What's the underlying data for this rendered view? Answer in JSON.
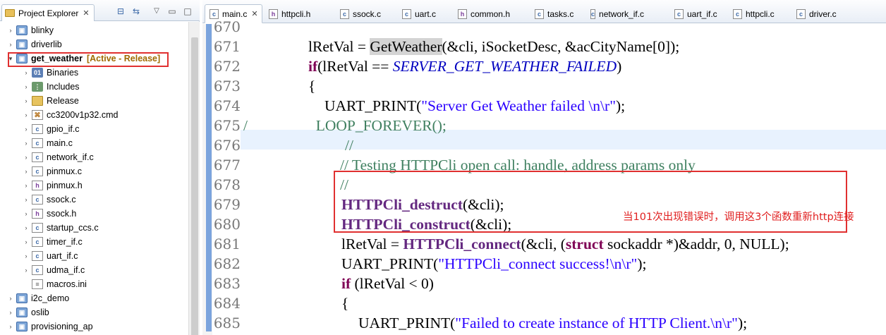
{
  "explorer": {
    "title": "Project Explorer",
    "tree": [
      {
        "label": "blinky",
        "twisty": "›",
        "icon": "project-icon"
      },
      {
        "label": "driverlib",
        "twisty": "›",
        "icon": "project-icon"
      },
      {
        "label": "get_weather",
        "twisty": "▾",
        "icon": "project-icon",
        "status": "[Active - Release]"
      },
      {
        "label": "Binaries",
        "twisty": "›",
        "icon": "binaries-icon"
      },
      {
        "label": "Includes",
        "twisty": "›",
        "icon": "includes-icon"
      },
      {
        "label": "Release",
        "twisty": "›",
        "icon": "folder-icon"
      },
      {
        "label": "cc3200v1p32.cmd",
        "twisty": "›",
        "icon": "cmd-file-icon"
      },
      {
        "label": "gpio_if.c",
        "twisty": "›",
        "icon": "c-file-icon"
      },
      {
        "label": "main.c",
        "twisty": "›",
        "icon": "c-file-icon"
      },
      {
        "label": "network_if.c",
        "twisty": "›",
        "icon": "c-file-icon"
      },
      {
        "label": "pinmux.c",
        "twisty": "›",
        "icon": "c-file-icon"
      },
      {
        "label": "pinmux.h",
        "twisty": "›",
        "icon": "h-file-icon"
      },
      {
        "label": "ssock.c",
        "twisty": "›",
        "icon": "c-file-icon"
      },
      {
        "label": "ssock.h",
        "twisty": "›",
        "icon": "h-file-icon"
      },
      {
        "label": "startup_ccs.c",
        "twisty": "›",
        "icon": "c-file-icon"
      },
      {
        "label": "timer_if.c",
        "twisty": "›",
        "icon": "c-file-icon"
      },
      {
        "label": "uart_if.c",
        "twisty": "›",
        "icon": "c-file-icon"
      },
      {
        "label": "udma_if.c",
        "twisty": "›",
        "icon": "c-file-icon"
      },
      {
        "label": "macros.ini",
        "twisty": "",
        "icon": "ini-file-icon"
      },
      {
        "label": "i2c_demo",
        "twisty": "›",
        "icon": "project-icon"
      },
      {
        "label": "oslib",
        "twisty": "›",
        "icon": "project-icon"
      },
      {
        "label": "provisioning_ap",
        "twisty": "›",
        "icon": "project-icon"
      }
    ]
  },
  "editor": {
    "tabs": [
      {
        "label": "main.c",
        "type": "c",
        "active": true
      },
      {
        "label": "httpcli.h",
        "type": "h"
      },
      {
        "label": "ssock.c",
        "type": "c"
      },
      {
        "label": "uart.c",
        "type": "c"
      },
      {
        "label": "common.h",
        "type": "h"
      },
      {
        "label": "tasks.c",
        "type": "c"
      },
      {
        "label": "network_if.c",
        "type": "c"
      },
      {
        "label": "uart_if.c",
        "type": "c"
      },
      {
        "label": "httpcli.c",
        "type": "c"
      },
      {
        "label": "driver.c",
        "type": "c"
      }
    ],
    "lines": [
      {
        "num": "670",
        "indent": 186,
        "segs": [
          [
            "",
            ""
          ]
        ]
      },
      {
        "num": "671",
        "indent": 92,
        "segs": [
          [
            "",
            "lRetVal = "
          ],
          [
            "hl",
            "GetWeather"
          ],
          [
            "",
            "(&cli, iSocketDesc, &acCityName[0]);"
          ]
        ]
      },
      {
        "num": "672",
        "indent": 92,
        "segs": [
          [
            "kw",
            "if"
          ],
          [
            "",
            "(lRetVal == "
          ],
          [
            "mac",
            "SERVER_GET_WEATHER_FAILED"
          ],
          [
            "",
            ")"
          ]
        ]
      },
      {
        "num": "673",
        "indent": 92,
        "segs": [
          [
            "",
            "{"
          ]
        ]
      },
      {
        "num": "674",
        "indent": 115,
        "segs": [
          [
            "",
            "UART_PRINT("
          ],
          [
            "str",
            "\"Server Get Weather failed \\n\\r\""
          ],
          [
            "",
            ");"
          ]
        ]
      },
      {
        "num": "675",
        "indent": -6,
        "segs": [
          [
            "cm",
            "//                  LOOP_FOREVER();"
          ]
        ]
      },
      {
        "num": "676",
        "indent": 144,
        "segs": [
          [
            "cm",
            "//"
          ]
        ]
      },
      {
        "num": "677",
        "indent": 137,
        "segs": [
          [
            "cm",
            "// Testing HTTPCli open call: handle, address params only"
          ]
        ]
      },
      {
        "num": "678",
        "indent": 137,
        "segs": [
          [
            "cm",
            "//"
          ]
        ]
      },
      {
        "num": "679",
        "indent": 139,
        "segs": [
          [
            "fn-bold",
            "HTTPCli_destruct"
          ],
          [
            "",
            "(&cli);"
          ]
        ]
      },
      {
        "num": "680",
        "indent": 139,
        "segs": [
          [
            "fn-bold",
            "HTTPCli_construct"
          ],
          [
            "",
            "(&cli);"
          ]
        ]
      },
      {
        "num": "681",
        "indent": 139,
        "segs": [
          [
            "",
            "lRetVal = "
          ],
          [
            "fn-bold",
            "HTTPCli_connect"
          ],
          [
            "",
            "(&cli, ("
          ],
          [
            "kw",
            "struct"
          ],
          [
            "",
            " sockaddr *)&addr, 0, NULL);"
          ]
        ]
      },
      {
        "num": "682",
        "indent": 139,
        "segs": [
          [
            "",
            "UART_PRINT("
          ],
          [
            "str",
            "\"HTTPCli_connect success!\\n\\r\""
          ],
          [
            "",
            ");"
          ]
        ]
      },
      {
        "num": "683",
        "indent": 139,
        "segs": [
          [
            "kw",
            "if"
          ],
          [
            "",
            " (lRetVal < 0)"
          ]
        ]
      },
      {
        "num": "684",
        "indent": 139,
        "segs": [
          [
            "",
            "{"
          ]
        ]
      },
      {
        "num": "685",
        "indent": 163,
        "segs": [
          [
            "",
            "UART_PRINT("
          ],
          [
            "str",
            "\"Failed to create instance of HTTP Client.\\n\\r\""
          ],
          [
            "",
            ");"
          ]
        ]
      }
    ],
    "annotation": "当101次出现错误时，调用这3个函数重新http连接"
  }
}
